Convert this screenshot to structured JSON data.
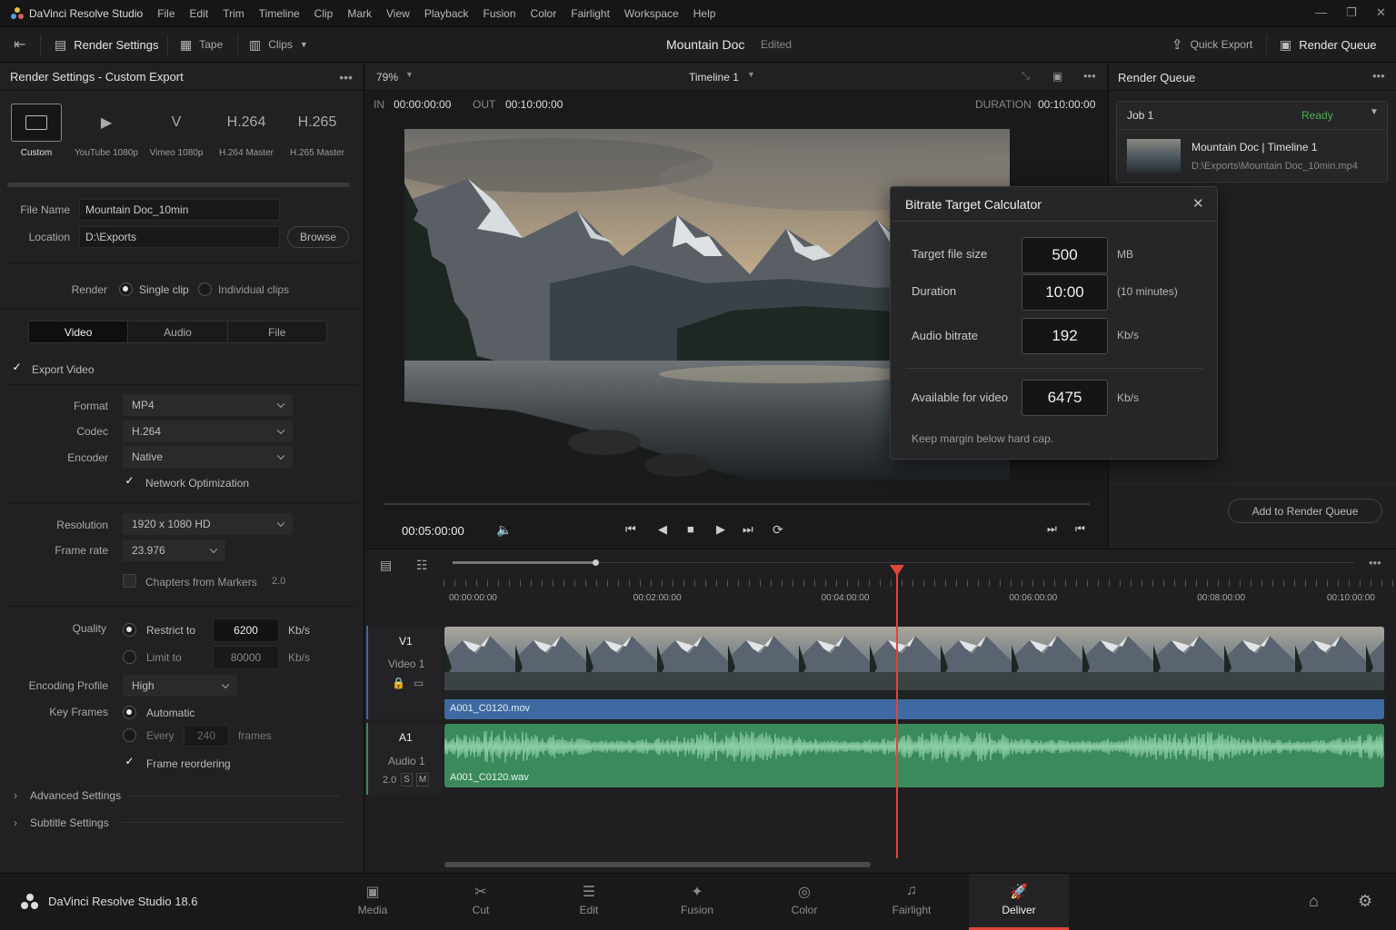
{
  "app": {
    "title": "DaVinci Resolve Studio",
    "menu": [
      "File",
      "Edit",
      "Trim",
      "Timeline",
      "Clip",
      "Mark",
      "View",
      "Playback",
      "Fusion",
      "Color",
      "Fairlight",
      "Workspace",
      "Help"
    ]
  },
  "toolbar": {
    "render_settings": "Render Settings",
    "tape": "Tape",
    "clips": "Clips",
    "project_name": "Mountain Doc",
    "project_status": "Edited",
    "quick_export": "Quick Export",
    "render_queue": "Render Queue"
  },
  "render_settings": {
    "header": "Render Settings - Custom Export",
    "presets": [
      {
        "label": "Custom",
        "icon": "film-frame-icon",
        "glyph": ""
      },
      {
        "label": "YouTube 1080p",
        "icon": "youtube-icon",
        "glyph": "▶"
      },
      {
        "label": "Vimeo 1080p",
        "icon": "vimeo-icon",
        "glyph": "V"
      },
      {
        "label": "H.264 Master",
        "icon": "h264-icon",
        "glyph": "H.264"
      },
      {
        "label": "H.265 Master",
        "icon": "h265-icon",
        "glyph": "H.265"
      }
    ],
    "file_name_label": "File Name",
    "file_name": "Mountain Doc_10min",
    "location_label": "Location",
    "location": "D:\\Exports",
    "browse": "Browse",
    "render_label": "Render",
    "single_clip": "Single clip",
    "individual_clips": "Individual clips",
    "tabs": [
      "Video",
      "Audio",
      "File"
    ],
    "export_video": "Export Video",
    "format_label": "Format",
    "format": "MP4",
    "codec_label": "Codec",
    "codec": "H.264",
    "encoder_label": "Encoder",
    "encoder": "Native",
    "network_opt": "Network Optimization",
    "resolution_label": "Resolution",
    "resolution": "1920 x 1080 HD",
    "frame_rate_label": "Frame rate",
    "frame_rate": "23.976",
    "chapters": "Chapters from Markers",
    "chapters_val": "2.0",
    "quality_label": "Quality",
    "restrict_to": "Restrict to",
    "restrict_val": "6200",
    "kbs": "Kb/s",
    "limit_to": "Limit to",
    "limit_val": "80000",
    "encoding_profile_label": "Encoding Profile",
    "encoding_profile": "High",
    "key_frames_label": "Key Frames",
    "automatic": "Automatic",
    "every": "Every",
    "every_val": "240",
    "frames": "frames",
    "frame_reordering": "Frame reordering",
    "advanced": "Advanced Settings",
    "subtitle": "Subtitle Settings"
  },
  "viewer": {
    "zoom": "79%",
    "timeline": "Timeline 1",
    "in_label": "IN",
    "in_tc": "00:00:00:00",
    "out_label": "OUT",
    "out_tc": "00:10:00:00",
    "duration_label": "DURATION",
    "duration_tc": "00:10:00:00",
    "current_tc": "00:05:00:00",
    "playhead_progress": 0.5
  },
  "render_queue": {
    "header": "Render Queue",
    "job": "Job 1",
    "status": "Ready",
    "job_title": "Mountain Doc | Timeline 1",
    "job_path": "D:\\Exports\\Mountain Doc_10min.mp4",
    "add_button": "Add to Render Queue"
  },
  "dialog": {
    "title": "Bitrate Target Calculator",
    "target_label": "Target file size",
    "target_val": "500",
    "target_unit": "MB",
    "duration_label": "Duration",
    "duration_val": "10:00",
    "duration_note": "(10 minutes)",
    "audio_label": "Audio bitrate",
    "audio_val": "192",
    "audio_unit": "Kb/s",
    "avail_label": "Available for video",
    "avail_val": "6475",
    "avail_unit": "Kb/s",
    "note": "Keep margin below hard cap."
  },
  "timeline": {
    "ruler": [
      "00:00:00:00",
      "00:02:00:00",
      "00:04:00:00",
      "00:06:00:00",
      "00:08:00:00",
      "00:10:00:00"
    ],
    "v1": "V1",
    "video1": "Video 1",
    "a1": "A1",
    "audio1": "Audio 1",
    "a1_ch": "2.0",
    "solo": "S",
    "mute": "M",
    "video_clip": "A001_C0120.mov",
    "audio_clip": "A001_C0120.wav",
    "playhead_progress": 0.482
  },
  "bottom": {
    "app_version": "DaVinci Resolve Studio 18.6",
    "pages": [
      {
        "label": "Media",
        "icon": "media-icon",
        "glyph": "▣"
      },
      {
        "label": "Cut",
        "icon": "cut-icon",
        "glyph": "✂"
      },
      {
        "label": "Edit",
        "icon": "edit-icon",
        "glyph": "☰"
      },
      {
        "label": "Fusion",
        "icon": "fusion-icon",
        "glyph": "✦"
      },
      {
        "label": "Color",
        "icon": "color-icon",
        "glyph": "◎"
      },
      {
        "label": "Fairlight",
        "icon": "fairlight-icon",
        "glyph": "♫"
      },
      {
        "label": "Deliver",
        "icon": "deliver-icon",
        "glyph": "🚀"
      }
    ]
  },
  "colors": {
    "accent_red": "#e0453a",
    "ready_green": "#4caf50",
    "video_track": "#3d6aa0",
    "audio_track": "#3a8a5c"
  }
}
